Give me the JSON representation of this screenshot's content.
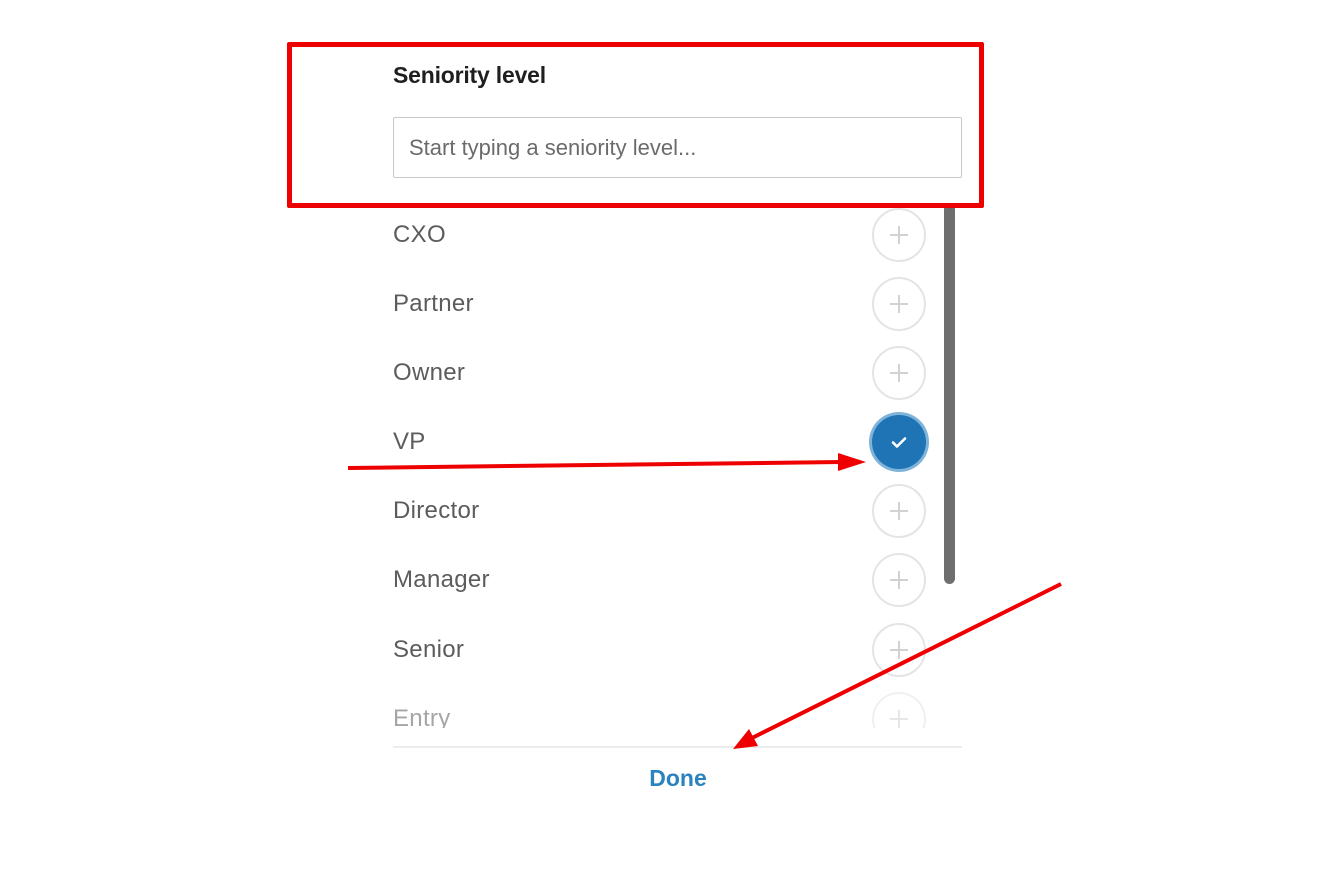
{
  "panel": {
    "title": "Seniority level",
    "search": {
      "placeholder": "Start typing a seniority level...",
      "value": ""
    },
    "items": [
      {
        "label": "CXO",
        "selected": false
      },
      {
        "label": "Partner",
        "selected": false
      },
      {
        "label": "Owner",
        "selected": false
      },
      {
        "label": "VP",
        "selected": true
      },
      {
        "label": "Director",
        "selected": false
      },
      {
        "label": "Manager",
        "selected": false
      },
      {
        "label": "Senior",
        "selected": false
      },
      {
        "label": "Entry",
        "selected": false
      }
    ],
    "done_label": "Done"
  },
  "icons": {
    "add": "plus-icon",
    "selected": "checkmark-icon"
  },
  "colors": {
    "selected_fill": "#1f74b5",
    "done_text": "#2a82c0",
    "annotation": "#ee0000"
  }
}
